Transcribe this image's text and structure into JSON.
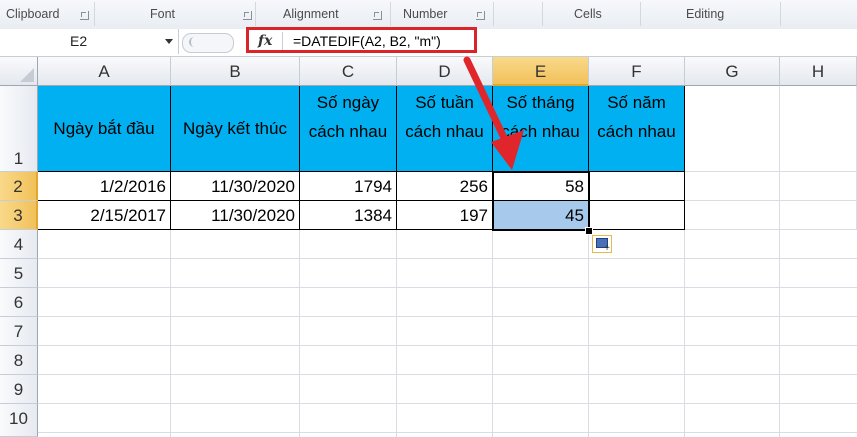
{
  "ribbon": {
    "groups": [
      {
        "label": "Clipboard",
        "launcher": true
      },
      {
        "label": "Font",
        "launcher": true
      },
      {
        "label": "Alignment",
        "launcher": true
      },
      {
        "label": "Number",
        "launcher": true
      },
      {
        "label": "Cells",
        "launcher": false
      },
      {
        "label": "Editing",
        "launcher": false
      }
    ]
  },
  "formula_bar": {
    "name_box": "E2",
    "fx_label": "fx",
    "formula": "=DATEDIF(A2, B2, \"m\")"
  },
  "sheet": {
    "columns": [
      "A",
      "B",
      "C",
      "D",
      "E",
      "F",
      "G",
      "H"
    ],
    "selected_column": "E",
    "rows": [
      "1",
      "2",
      "3",
      "4",
      "5",
      "6",
      "7",
      "8",
      "9",
      "10"
    ],
    "selected_rows": [
      "2",
      "3"
    ],
    "header_row": [
      "Ngày bắt đầu",
      "Ngày kết thúc",
      "Số ngày cách nhau",
      "Số tuần cách nhau",
      "Số tháng cách nhau",
      "Số năm cách nhau"
    ],
    "data_rows": [
      [
        "1/2/2016",
        "11/30/2020",
        "1794",
        "256",
        "58",
        ""
      ],
      [
        "2/15/2017",
        "11/30/2020",
        "1384",
        "197",
        "45",
        ""
      ]
    ],
    "active_cell": "E2",
    "fill_selection": "E3"
  },
  "colors": {
    "header_fill": "#00b0f0",
    "selection_fill": "#a6c9ec",
    "annotation_red": "#d9242a",
    "selected_header": "#f1c15a"
  }
}
